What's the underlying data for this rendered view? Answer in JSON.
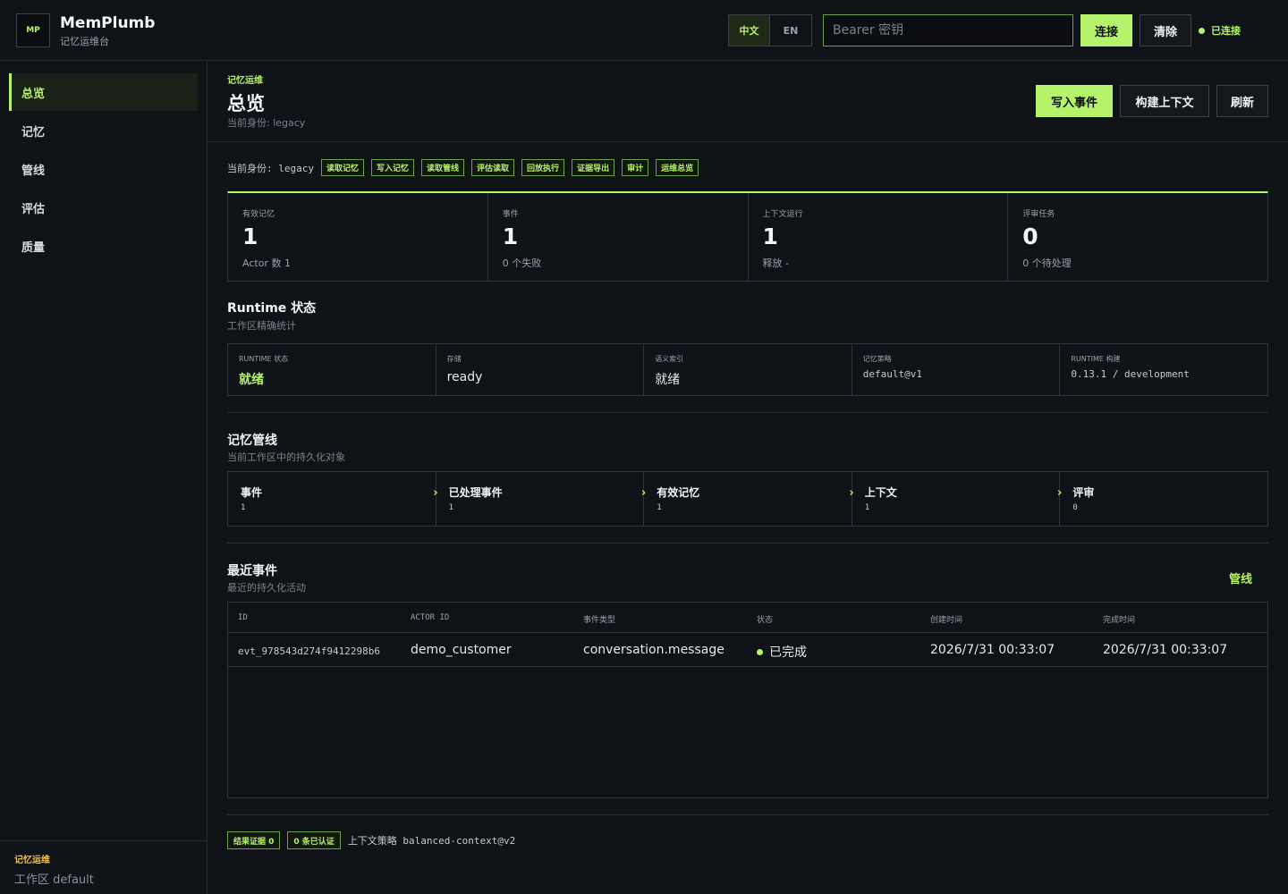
{
  "brand": {
    "logo": "MP",
    "name": "MemPlumb",
    "subtitle": "记忆运维台"
  },
  "topbar": {
    "lang_zh": "中文",
    "lang_en": "EN",
    "token_placeholder": "Bearer 密钥",
    "connect_label": "连接",
    "clear_label": "清除",
    "status_label": "已连接"
  },
  "sidebar": {
    "items": [
      {
        "label": "总览",
        "active": true
      },
      {
        "label": "记忆"
      },
      {
        "label": "管线"
      },
      {
        "label": "评估"
      },
      {
        "label": "质量"
      }
    ],
    "footer_title": "记忆运维",
    "footer_workspace": "工作区 default"
  },
  "header": {
    "eyebrow": "记忆运维",
    "title": "总览",
    "identity": "当前身份: legacy",
    "write_event": "写入事件",
    "build_context": "构建上下文",
    "refresh": "刷新"
  },
  "permissions": {
    "label": "当前身份: legacy",
    "chips": [
      "读取记忆",
      "写入记忆",
      "读取管线",
      "评估读取",
      "回放执行",
      "证据导出",
      "审计",
      "运维总览"
    ]
  },
  "stats": [
    {
      "label": "有效记忆",
      "value": "1",
      "sub": "Actor 数 1"
    },
    {
      "label": "事件",
      "value": "1",
      "sub": "0 个失败"
    },
    {
      "label": "上下文运行",
      "value": "1",
      "sub": "释放 -"
    },
    {
      "label": "评审任务",
      "value": "0",
      "sub": "0 个待处理"
    }
  ],
  "runtime": {
    "title": "Runtime 状态",
    "subtitle": "工作区精确统计",
    "cells": [
      {
        "label": "RUNTIME 状态",
        "value": "就绪"
      },
      {
        "label": "存储",
        "value": "ready"
      },
      {
        "label": "语义索引",
        "value": "就绪"
      },
      {
        "label": "记忆策略",
        "value": "default@v1"
      },
      {
        "label": "RUNTIME 构建",
        "value": "0.13.1 / development"
      }
    ]
  },
  "pipeline": {
    "title": "记忆管线",
    "subtitle": "当前工作区中的持久化对象",
    "stages": [
      {
        "name": "事件",
        "count": "1"
      },
      {
        "name": "已处理事件",
        "count": "1"
      },
      {
        "name": "有效记忆",
        "count": "1"
      },
      {
        "name": "上下文",
        "count": "1"
      },
      {
        "name": "评审",
        "count": "0"
      }
    ]
  },
  "recent": {
    "title": "最近事件",
    "subtitle": "最近的持久化活动",
    "link": "管线",
    "columns": [
      "ID",
      "ACTOR ID",
      "事件类型",
      "状态",
      "创建时间",
      "完成时间"
    ],
    "rows": [
      {
        "id": "evt_978543d274f9412298b6",
        "actor": "demo_customer",
        "type": "conversation.message",
        "status": "已完成",
        "created": "2026/7/31 00:33:07",
        "completed": "2026/7/31 00:33:07"
      }
    ]
  },
  "footer": {
    "evidence": "结果证据 0",
    "verified": "0 条已认证",
    "policy": "上下文策略 balanced-context@v2"
  },
  "colors": {
    "accent": "#b5f36b",
    "background": "#0f1216",
    "border": "#2e343b",
    "warning": "#f0c14b"
  }
}
